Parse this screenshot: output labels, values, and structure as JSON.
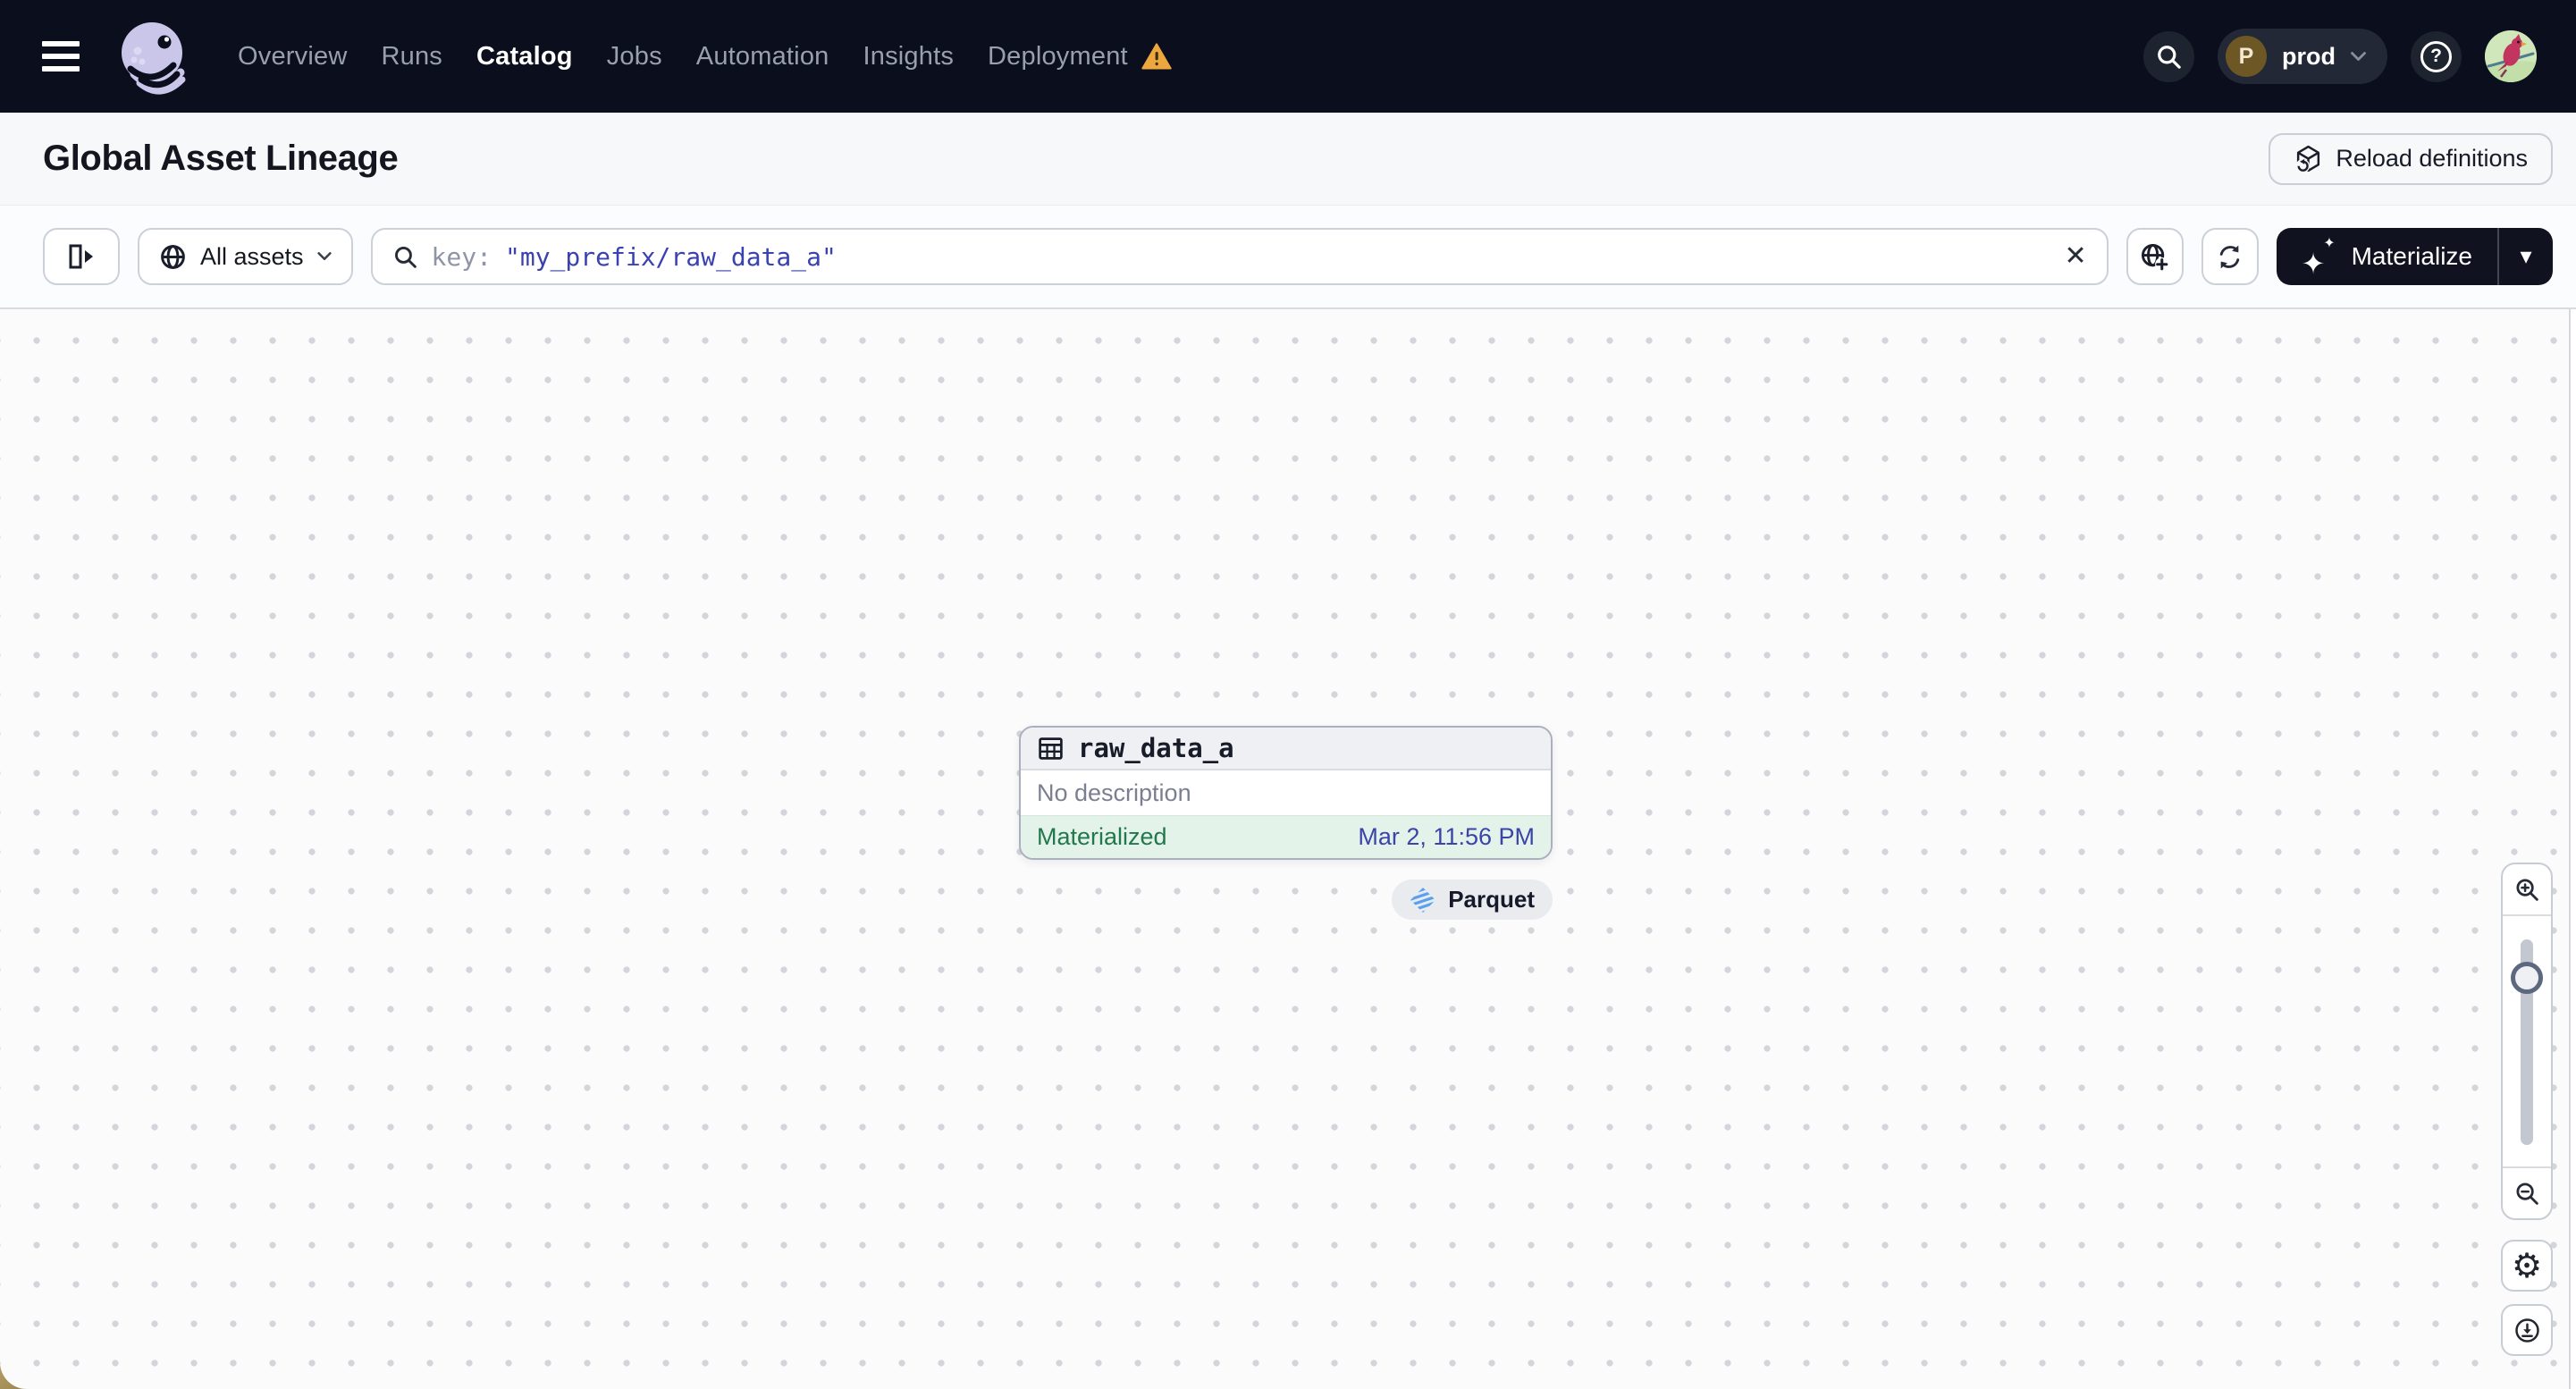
{
  "nav": {
    "items": [
      {
        "label": "Overview"
      },
      {
        "label": "Runs"
      },
      {
        "label": "Catalog",
        "active": true
      },
      {
        "label": "Jobs"
      },
      {
        "label": "Automation"
      },
      {
        "label": "Insights"
      },
      {
        "label": "Deployment",
        "warning": true
      }
    ],
    "environment": {
      "initial": "P",
      "name": "prod"
    }
  },
  "header": {
    "title": "Global Asset Lineage",
    "reload_label": "Reload definitions"
  },
  "toolbar": {
    "scope_label": "All assets",
    "search_prefix": "key:",
    "search_value": "\"my_prefix/raw_data_a\"",
    "materialize_label": "Materialize"
  },
  "graph": {
    "node": {
      "name": "raw_data_a",
      "description": "No description",
      "status": "Materialized",
      "materialized_at": "Mar 2, 11:56 PM",
      "kind_tag": "Parquet"
    }
  },
  "icons": {
    "help_glyph": "?",
    "clear_glyph": "✕",
    "sparkle_large": "✦",
    "sparkle_small": "✦",
    "dropdown_caret": "▾",
    "gear_glyph": "⚙"
  },
  "colors": {
    "navbar_bg": "#0b0e1c",
    "accent_indigo": "#3a41b0",
    "status_green": "#20784b",
    "status_bg_mint": "#e4f3ea",
    "warning_amber": "#eda73f",
    "parquet_blue": "#59a1ee",
    "desktop_tan": "#b39c66"
  }
}
